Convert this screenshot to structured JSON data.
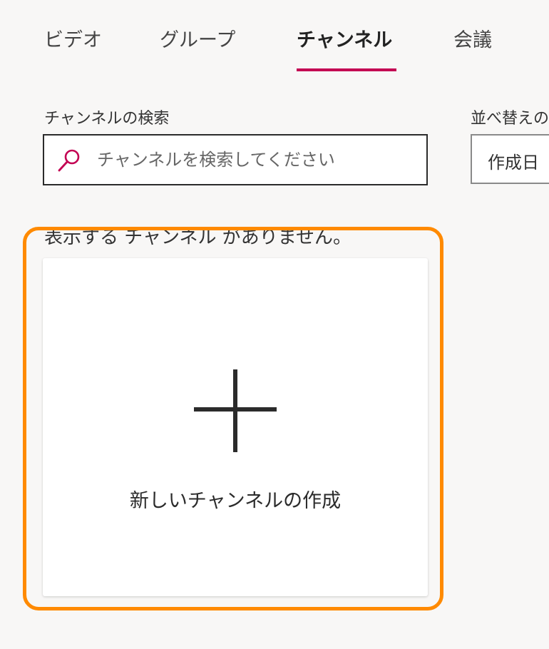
{
  "tabs": [
    {
      "label": "ビデオ",
      "active": false
    },
    {
      "label": "グループ",
      "active": false
    },
    {
      "label": "チャンネル",
      "active": true
    },
    {
      "label": "会議",
      "active": false
    }
  ],
  "search": {
    "label": "チャンネルの検索",
    "placeholder": "チャンネルを検索してください",
    "icon": "search-icon"
  },
  "sort": {
    "label": "並べ替えの",
    "selected": "作成日"
  },
  "content": {
    "empty_message": "表示する チャンネル がありません。",
    "create_label": "新しいチャンネルの作成",
    "create_icon": "plus-icon"
  },
  "colors": {
    "accent": "#c30052",
    "highlight": "#ff8a00",
    "background": "#f8f7f6"
  }
}
